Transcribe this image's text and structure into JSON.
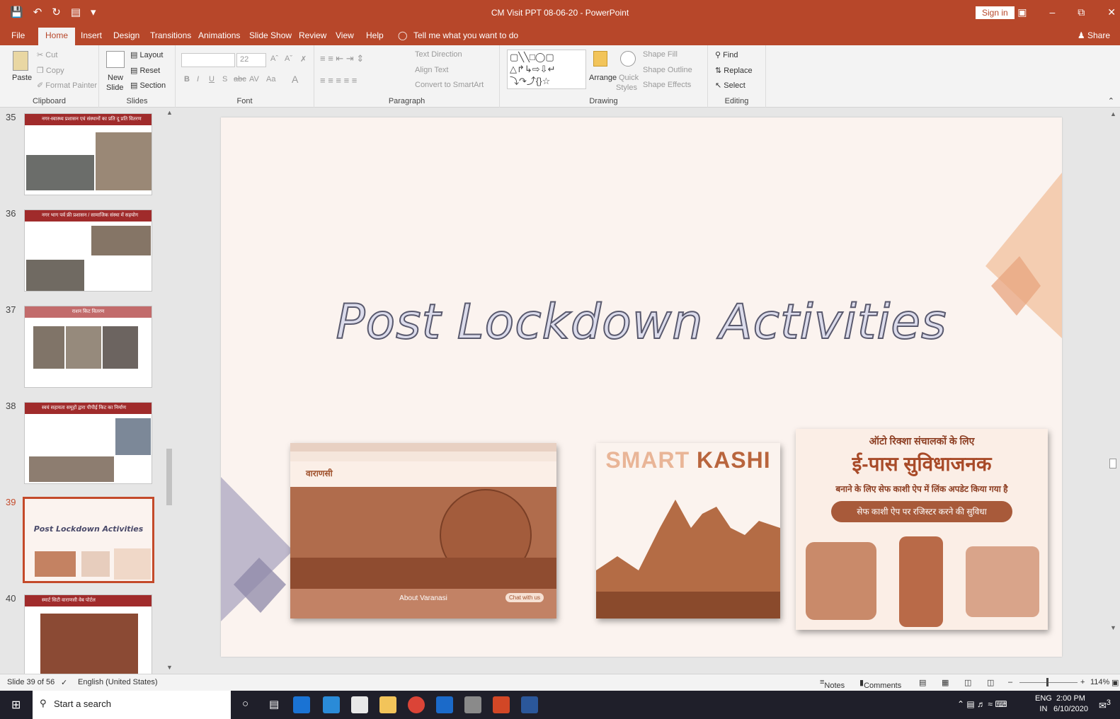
{
  "window": {
    "title": "CM Visit PPT 08-06-20  -  PowerPoint",
    "sign_in": "Sign in",
    "share": "Share"
  },
  "menu": {
    "tabs": [
      "File",
      "Home",
      "Insert",
      "Design",
      "Transitions",
      "Animations",
      "Slide Show",
      "Review",
      "View",
      "Help"
    ],
    "active": "Home",
    "tell_me": "Tell me what you want to do"
  },
  "ribbon": {
    "clipboard": {
      "label": "Clipboard",
      "paste": "Paste",
      "cut": "Cut",
      "copy": "Copy",
      "format_painter": "Format Painter"
    },
    "slides": {
      "label": "Slides",
      "new_slide": "New",
      "new_slide2": "Slide",
      "layout": "Layout",
      "reset": "Reset",
      "section": "Section"
    },
    "font": {
      "label": "Font",
      "size": "22",
      "bold": "B",
      "italic": "I",
      "underline": "U",
      "shadow": "S",
      "strike": "abc",
      "spacing": "AV",
      "case": "Aa"
    },
    "paragraph": {
      "label": "Paragraph",
      "text_direction": "Text Direction",
      "align_text": "Align Text",
      "smartart": "Convert to SmartArt"
    },
    "drawing": {
      "label": "Drawing",
      "arrange": "Arrange",
      "quick_styles": "Quick",
      "quick_styles2": "Styles",
      "shape_fill": "Shape Fill",
      "shape_outline": "Shape Outline",
      "shape_effects": "Shape Effects"
    },
    "editing": {
      "label": "Editing",
      "find": "Find",
      "replace": "Replace",
      "select": "Select"
    }
  },
  "thumbnails": [
    {
      "num": "35",
      "title": "नगर-स्वास्थ्य प्रशासन एवं संस्थानों का प्रति दू प्रति वितरण"
    },
    {
      "num": "36",
      "title": "नगर भाग पर्व फ्री प्रशासन / सामाजिक संस्था में सहयोग"
    },
    {
      "num": "37",
      "title": "राशन किट वितरण"
    },
    {
      "num": "38",
      "title": "स्वयं सहायता समूहों द्वारा पीपीई किट का निर्माण"
    },
    {
      "num": "39",
      "title": "Post Lockdown Activities"
    },
    {
      "num": "40",
      "title": "स्मार्ट सिटी वाराणसी वेब पोर्टल"
    }
  ],
  "slide": {
    "title": "Post Lockdown Activities",
    "pic1": {
      "caption": "About Varanasi",
      "chat": "Chat with us",
      "logo": "वाराणसी"
    },
    "pic2": {
      "brand_part1": "SMART",
      "brand_part2": "KASHI"
    },
    "pic3": {
      "line1": "ऑटो रिक्शा संचालकों के लिए",
      "line2": "ई-पास सुविधाजनक",
      "line3": "बनाने के लिए सेफ काशी ऐप में लिंक अपडेट किया गया है",
      "line4": "सेफ काशी ऐप पर रजिस्टर करने की सुविधा"
    }
  },
  "status": {
    "slide_info": "Slide 39 of 56",
    "language": "English (United States)",
    "notes": "Notes",
    "comments": "Comments",
    "zoom": "114%"
  },
  "taskbar": {
    "search": "Start a search",
    "lang1": "ENG",
    "lang2": "IN",
    "time": "2:00 PM",
    "date": "6/10/2020",
    "notif": "3"
  },
  "colors": {
    "accent": "#b7472a",
    "slide_bg": "#fbf3ef",
    "sepia": "#b9653d"
  }
}
